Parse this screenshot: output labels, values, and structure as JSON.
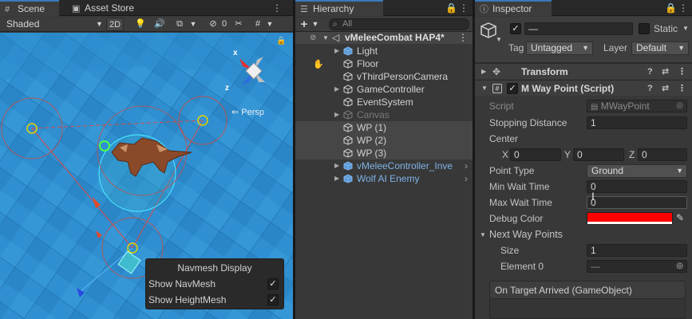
{
  "scene_panel": {
    "tabs": [
      {
        "label": "Scene",
        "icon": "grid-icon"
      },
      {
        "label": "Asset Store",
        "icon": "store-icon"
      }
    ],
    "shading_mode": "Shaded",
    "toggle_2d": "2D",
    "gizmo_badge": "0",
    "persp_label": "Persp",
    "axis_x": "x",
    "axis_z": "z",
    "navmesh_display": {
      "title": "Navmesh Display",
      "show_navmesh": "Show NavMesh",
      "show_heightmesh": "Show HeightMesh",
      "navmesh_checked": true,
      "heightmesh_checked": true
    }
  },
  "hierarchy_panel": {
    "tab": "Hierarchy",
    "search_placeholder": "All",
    "add_symbol": "+",
    "scene_root": "vMeleeCombat HAP4*",
    "items": [
      {
        "label": "Light",
        "type": "prefab-cube",
        "arrow": true
      },
      {
        "label": "Floor",
        "type": "cube",
        "arrow": false
      },
      {
        "label": "vThirdPersonCamera",
        "type": "cube",
        "arrow": false
      },
      {
        "label": "GameController",
        "type": "cube",
        "arrow": true
      },
      {
        "label": "EventSystem",
        "type": "cube",
        "arrow": false
      },
      {
        "label": "Canvas",
        "type": "cube",
        "arrow": true,
        "disabled": true
      },
      {
        "label": "WP (1)",
        "type": "cube",
        "arrow": false,
        "selected": true
      },
      {
        "label": "WP (2)",
        "type": "cube",
        "arrow": false,
        "selected": true
      },
      {
        "label": "WP (3)",
        "type": "cube",
        "arrow": false,
        "selected": true
      },
      {
        "label": "vMeleeController_Inve",
        "type": "prefab",
        "arrow": true,
        "prefab": true
      },
      {
        "label": "Wolf AI Enemy",
        "type": "prefab",
        "arrow": true,
        "prefab": true
      }
    ]
  },
  "inspector_panel": {
    "tab": "Inspector",
    "object_name": "—",
    "static_label": "Static",
    "tag_label": "Tag",
    "tag_value": "Untagged",
    "layer_label": "Layer",
    "layer_value": "Default",
    "transform_title": "Transform",
    "component_title": "M Way Point (Script)",
    "script_label": "Script",
    "script_value": "MWayPoint",
    "stopping_distance_label": "Stopping Distance",
    "stopping_distance_value": "1",
    "center_label": "Center",
    "center_x_label": "X",
    "center_x": "0",
    "center_y_label": "Y",
    "center_y": "0",
    "center_z_label": "Z",
    "center_z": "0",
    "point_type_label": "Point Type",
    "point_type_value": "Ground",
    "min_wait_label": "Min Wait Time",
    "min_wait_value": "0",
    "max_wait_label": "Max Wait Time",
    "max_wait_value": "0",
    "debug_color_label": "Debug Color",
    "debug_color": "#ff0000",
    "next_way_points_label": "Next Way Points",
    "size_label": "Size",
    "size_value": "1",
    "element0_label": "Element 0",
    "element0_value": "—",
    "event_title": "On Target Arrived (GameObject)"
  },
  "colors": {
    "accent": "#3a79bb",
    "panel_bg": "#383838",
    "scene_water": "#2f8fd0",
    "prefab_text": "#7fb2e6"
  }
}
